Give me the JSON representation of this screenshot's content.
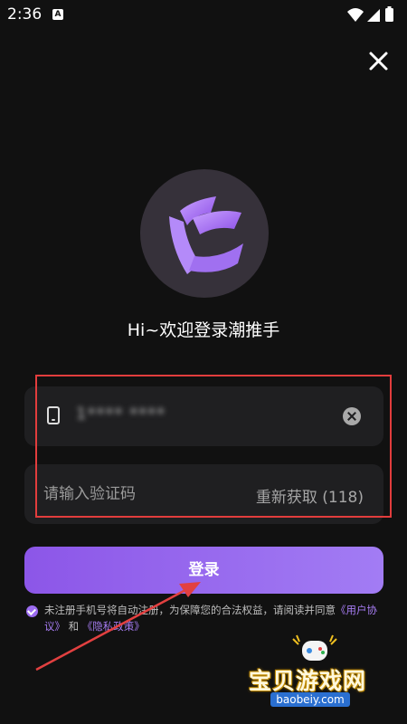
{
  "status_bar": {
    "time": "2:36",
    "notification_letter": "A"
  },
  "welcome_text": "Hi~欢迎登录潮推手",
  "phone_field": {
    "value": "1**** ****"
  },
  "code_field": {
    "placeholder": "请输入验证码",
    "resend_label": "重新获取 (118)"
  },
  "login_button": {
    "label": "登录"
  },
  "agreement": {
    "prefix": "未注册手机号将自动注册，为保障您的合法权益，请阅读并同意",
    "user_agreement": "《用户协议》",
    "and": "和",
    "privacy_policy": "《隐私政策》"
  },
  "watermark": {
    "title": "宝贝游戏网",
    "url": "baobeiy.com"
  },
  "colors": {
    "accent": "#9c6cf1",
    "background": "#111111",
    "field": "#1f1f21",
    "highlight": "#e23d3d"
  },
  "icons": [
    "wifi-icon",
    "signal-icon",
    "battery-icon",
    "close-icon",
    "app-logo-icon",
    "phone-icon",
    "clear-icon",
    "check-icon"
  ]
}
